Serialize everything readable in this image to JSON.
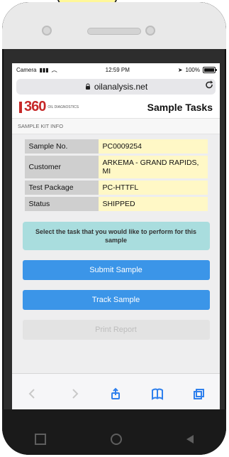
{
  "status": {
    "carrier": "Camera",
    "time": "12:59 PM",
    "battery": "100%"
  },
  "url": {
    "domain": "oilanalysis.net"
  },
  "header": {
    "logo_text": "360",
    "logo_sub": "OIL DIAGNOSTICS",
    "title": "Sample Tasks"
  },
  "section": {
    "title": "SAMPLE KIT INFO"
  },
  "sample_info": [
    {
      "label": "Sample No.",
      "value": "PC0009254"
    },
    {
      "label": "Customer",
      "value": "ARKEMA - GRAND RAPIDS, MI"
    },
    {
      "label": "Test Package",
      "value": "PC-HTTFL"
    },
    {
      "label": "Status",
      "value": "SHIPPED"
    }
  ],
  "notice": {
    "text": "Select the task that you would like to perform for this sample"
  },
  "buttons": {
    "submit": "Submit Sample",
    "track": "Track Sample",
    "print": "Print Report"
  },
  "icons": {
    "back": "chevron-left-icon",
    "forward": "chevron-right-icon",
    "share": "share-icon",
    "bookmarks": "book-icon",
    "tabs": "tabs-icon"
  },
  "colors": {
    "primary_button": "#3b95e8",
    "notice_bg": "#a9ddde",
    "value_bg": "#fff8c6",
    "label_bg": "#cfcfcf",
    "logo_red": "#c62828"
  }
}
